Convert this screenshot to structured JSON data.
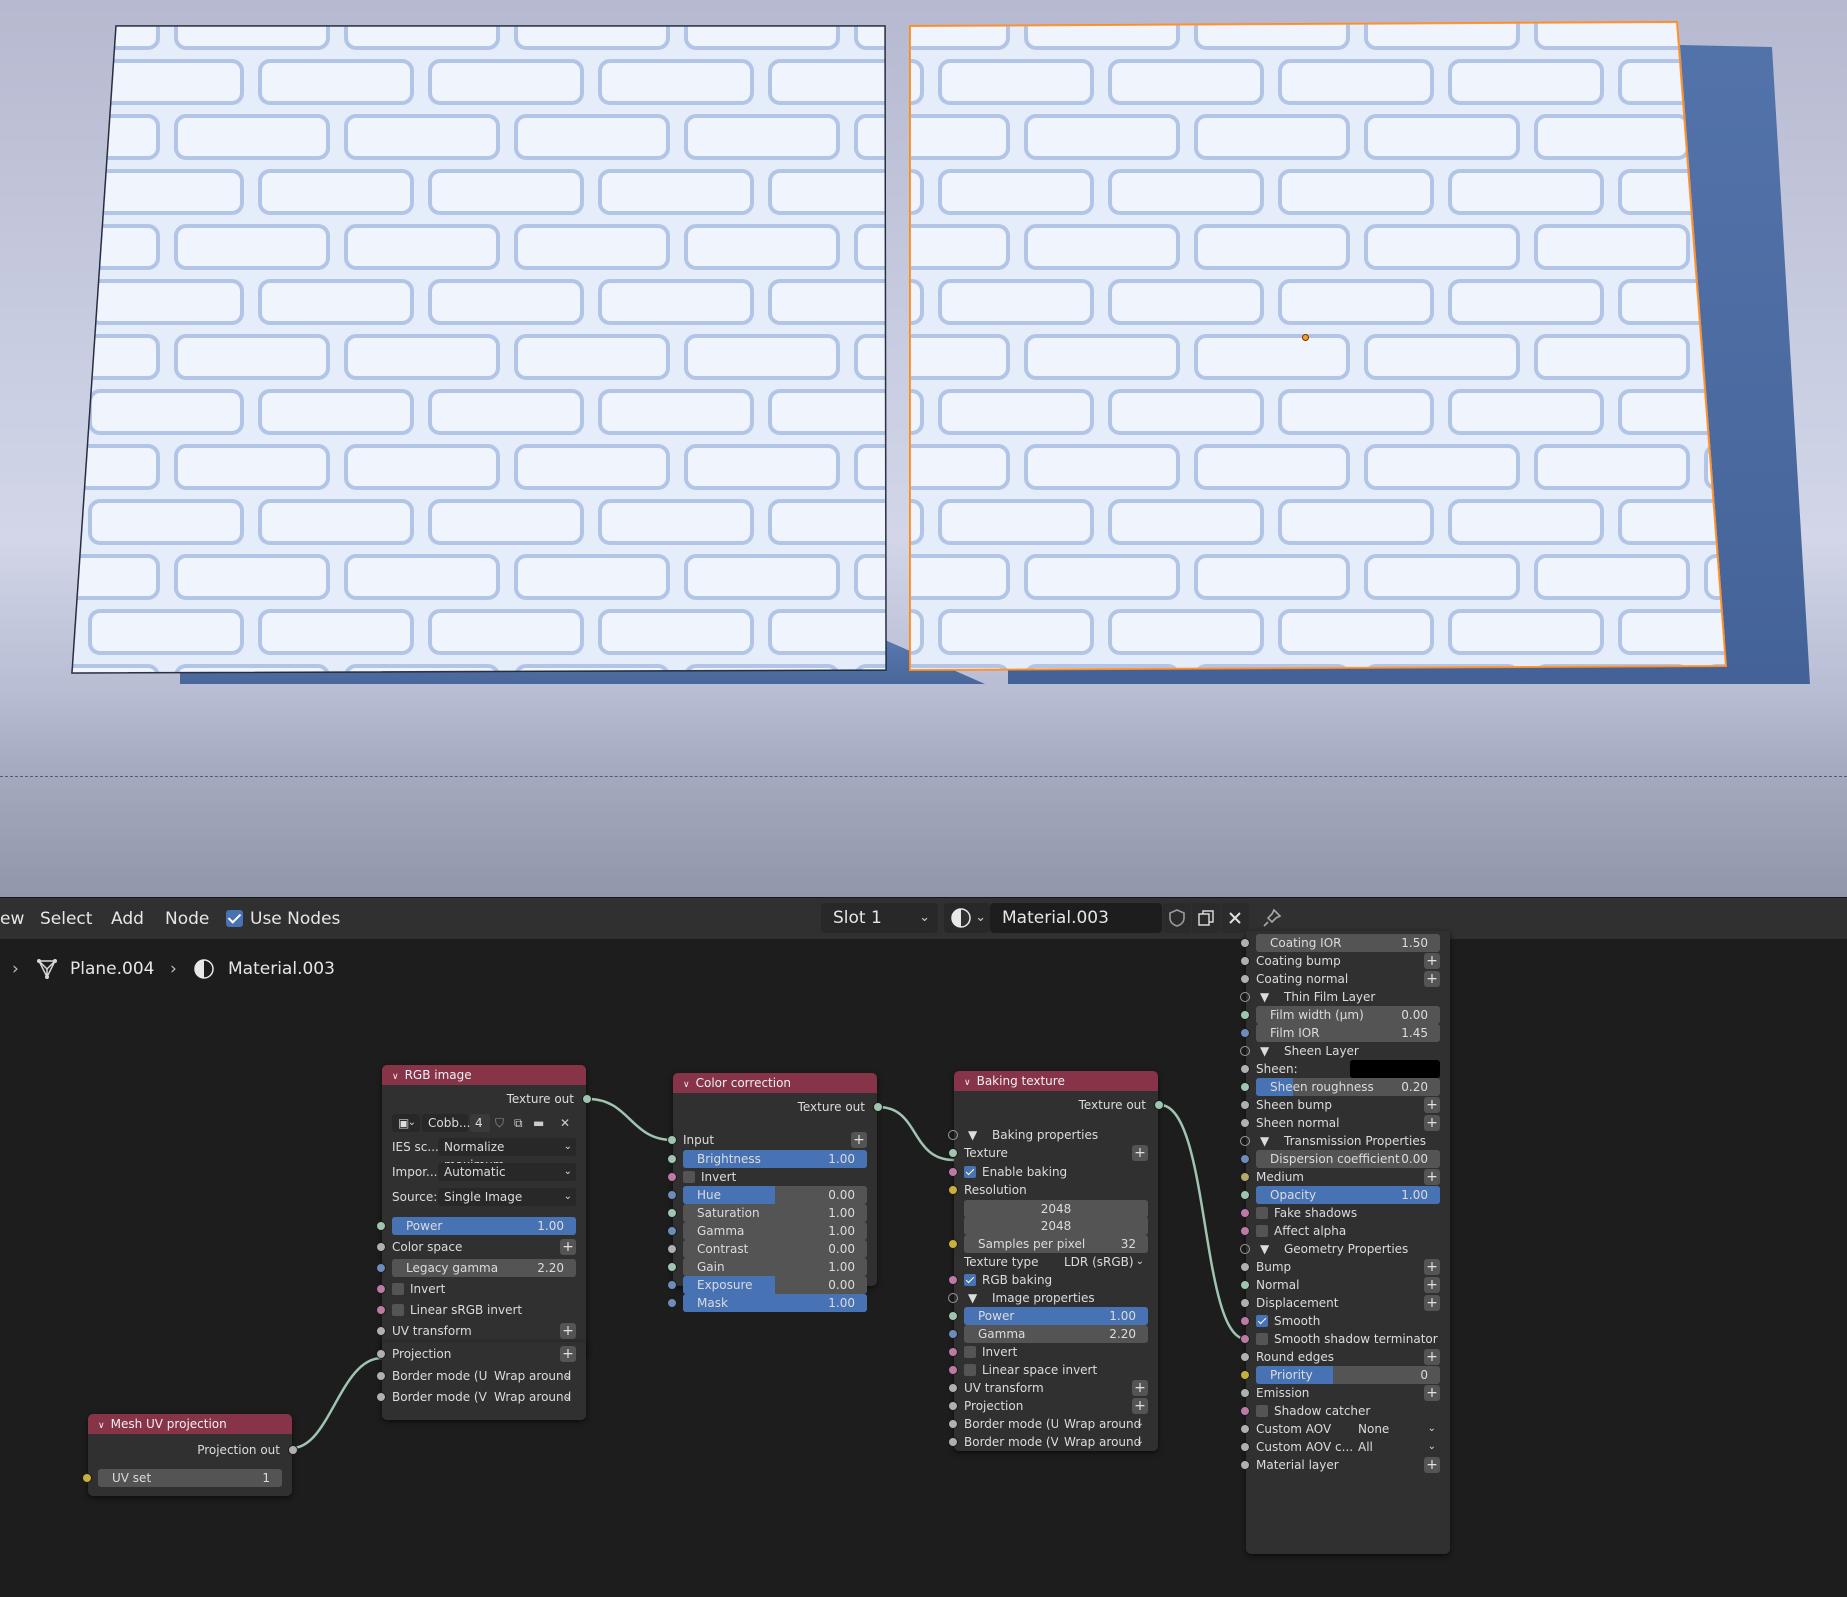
{
  "header": {
    "menu": [
      "ew",
      "Select",
      "Add",
      "Node"
    ],
    "use_nodes_label": "Use Nodes",
    "slot": "Slot 1",
    "material_name": "Material.003"
  },
  "breadcrumb": {
    "object": "Plane.004",
    "material": "Material.003"
  },
  "nodes": {
    "mesh_uv": {
      "title": "Mesh UV projection",
      "output": "Projection out",
      "uv_set_label": "UV set",
      "uv_set_value": "1"
    },
    "rgb_image": {
      "title": "RGB image",
      "output": "Texture out",
      "image_name": "Cobb...",
      "image_users": "4",
      "ies_label": "IES sc...",
      "ies_value": "Normalize maximum...",
      "import_label": "Impor...",
      "import_value": "Automatic",
      "source_label": "Source:",
      "source_value": "Single Image",
      "power_label": "Power",
      "power_value": "1.00",
      "color_space": "Color space",
      "gamma_label": "Legacy gamma",
      "gamma_value": "2.20",
      "invert": "Invert",
      "linear_invert": "Linear sRGB invert",
      "uv_transform": "UV transform",
      "projection": "Projection",
      "border_u_label": "Border mode (U)",
      "border_u_value": "Wrap around",
      "border_v_label": "Border mode (V)",
      "border_v_value": "Wrap around"
    },
    "color_correction": {
      "title": "Color correction",
      "output": "Texture out",
      "input": "Input",
      "invert": "Invert",
      "params": [
        {
          "label": "Brightness",
          "value": "1.00",
          "fill": 1.0
        },
        {
          "label": "Hue",
          "value": "0.00",
          "fill": 0.5
        },
        {
          "label": "Saturation",
          "value": "1.00",
          "fill": 0.0
        },
        {
          "label": "Gamma",
          "value": "1.00",
          "fill": 0.0
        },
        {
          "label": "Contrast",
          "value": "0.00",
          "fill": 0.0
        },
        {
          "label": "Gain",
          "value": "1.00",
          "fill": 0.0
        },
        {
          "label": "Exposure",
          "value": "0.00",
          "fill": 0.5
        },
        {
          "label": "Mask",
          "value": "1.00",
          "fill": 1.0
        }
      ]
    },
    "baking_texture": {
      "title": "Baking texture",
      "output": "Texture out",
      "baking_properties": "Baking properties",
      "texture": "Texture",
      "enable_baking": "Enable baking",
      "resolution": "Resolution",
      "res_x": "2048",
      "res_y": "2048",
      "samples_label": "Samples per pixel",
      "samples_value": "32",
      "texture_type_label": "Texture type",
      "texture_type_value": "LDR (sRGB)",
      "rgb_baking": "RGB baking",
      "image_properties": "Image properties",
      "power_label": "Power",
      "power_value": "1.00",
      "gamma_label": "Gamma",
      "gamma_value": "2.20",
      "invert": "Invert",
      "linear_invert": "Linear space invert",
      "uv_transform": "UV transform",
      "projection": "Projection",
      "border_u_label": "Border mode (U)",
      "border_u_value": "Wrap around",
      "border_v_label": "Border mode (V)",
      "border_v_value": "Wrap around"
    },
    "material": {
      "coating_ior_label": "Coating IOR",
      "coating_ior_value": "1.50",
      "coating_bump": "Coating bump",
      "coating_normal": "Coating normal",
      "thin_film": "Thin Film Layer",
      "film_width_label": "Film width (µm)",
      "film_width_value": "0.00",
      "film_ior_label": "Film IOR",
      "film_ior_value": "1.45",
      "sheen_layer": "Sheen Layer",
      "sheen": "Sheen:",
      "sheen_roughness_label": "Sheen roughness",
      "sheen_roughness_value": "0.20",
      "sheen_bump": "Sheen bump",
      "sheen_normal": "Sheen normal",
      "transmission": "Transmission Properties",
      "dispersion_label": "Dispersion coefficient",
      "dispersion_value": "0.00",
      "medium": "Medium",
      "opacity_label": "Opacity",
      "opacity_value": "1.00",
      "fake_shadows": "Fake shadows",
      "affect_alpha": "Affect alpha",
      "geometry": "Geometry Properties",
      "bump": "Bump",
      "normal": "Normal",
      "displacement": "Displacement",
      "smooth": "Smooth",
      "smooth_terminator": "Smooth shadow terminator",
      "round_edges": "Round edges",
      "priority_label": "Priority",
      "priority_value": "0",
      "emission": "Emission",
      "shadow_catcher": "Shadow catcher",
      "custom_aov_label": "Custom AOV",
      "custom_aov_value": "None",
      "custom_aov_c_label": "Custom AOV c...",
      "custom_aov_c_value": "All",
      "material_layer": "Material layer"
    }
  },
  "colors": {
    "node_header": "#873348",
    "accent": "#4772b3",
    "selection_outline": "#ff8a1e"
  }
}
